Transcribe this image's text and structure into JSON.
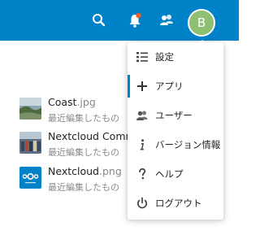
{
  "header": {
    "avatar_initial": "B",
    "brand_color": "#0082c9",
    "avatar_color": "#8fbf73",
    "notification_dot_color": "#e8612c",
    "icons": [
      "search-icon",
      "notifications-icon",
      "contacts-icon"
    ]
  },
  "files": [
    {
      "name": "Coast",
      "ext": ".jpg",
      "subtitle": "最近編集したもの",
      "thumb": "photo-coast"
    },
    {
      "name": "Nextcloud Community",
      "ext": "",
      "subtitle": "最近編集したもの",
      "thumb": "photo-community"
    },
    {
      "name": "Nextcloud",
      "ext": ".png",
      "subtitle": "最近編集したもの",
      "thumb": "nextcloud-logo"
    }
  ],
  "menu": {
    "items": [
      {
        "label": "設定",
        "icon": "settings-list-icon",
        "active": false
      },
      {
        "label": "アプリ",
        "icon": "plus-icon",
        "active": true
      },
      {
        "label": "ユーザー",
        "icon": "users-icon",
        "active": false
      },
      {
        "label": "バージョン情報",
        "icon": "info-icon",
        "active": false
      },
      {
        "label": "ヘルプ",
        "icon": "help-icon",
        "active": false
      },
      {
        "label": "ログアウト",
        "icon": "power-icon",
        "active": false
      }
    ]
  }
}
